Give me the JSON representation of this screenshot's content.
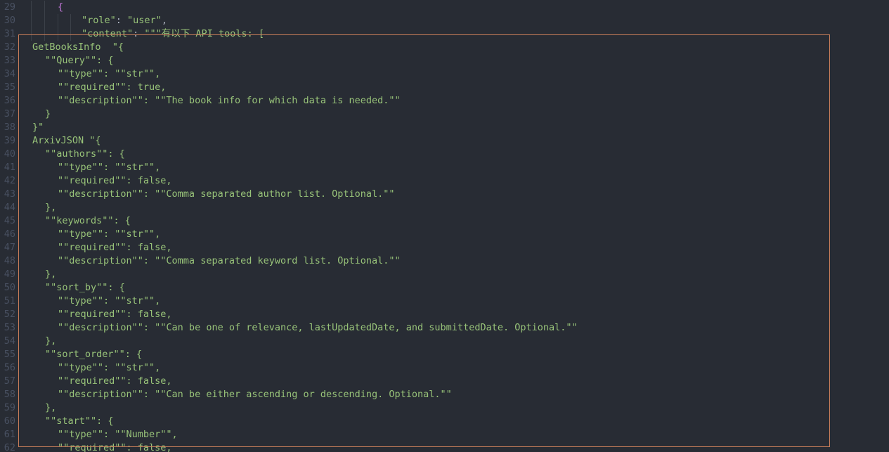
{
  "editor": {
    "lines": [
      {
        "n": "29",
        "ind": 82,
        "guides": [
          44,
          63
        ],
        "segs": [
          {
            "c": "b",
            "t": "{"
          }
        ]
      },
      {
        "n": "30",
        "ind": 116,
        "guides": [
          44,
          63,
          82,
          100
        ],
        "segs": [
          {
            "c": "s",
            "t": "\"role\""
          },
          {
            "c": "p",
            "t": ": "
          },
          {
            "c": "s",
            "t": "\"user\""
          },
          {
            "c": "p",
            "t": ","
          }
        ]
      },
      {
        "n": "31",
        "ind": 116,
        "guides": [
          44,
          63,
          82,
          100
        ],
        "segs": [
          {
            "c": "s",
            "t": "\"content\""
          },
          {
            "c": "p",
            "t": ": "
          },
          {
            "c": "s",
            "t": "\"\"\"有以下 API tools: ["
          }
        ]
      },
      {
        "n": "32",
        "ind": 46,
        "guides": [],
        "segs": [
          {
            "c": "t",
            "t": "GetBooksInfo  \"{"
          }
        ]
      },
      {
        "n": "33",
        "ind": 64,
        "guides": [],
        "segs": [
          {
            "c": "t",
            "t": "\"\"Query\"\": {"
          }
        ]
      },
      {
        "n": "34",
        "ind": 82,
        "guides": [],
        "segs": [
          {
            "c": "t",
            "t": "\"\"type\"\": \"\"str\"\","
          }
        ]
      },
      {
        "n": "35",
        "ind": 82,
        "guides": [],
        "segs": [
          {
            "c": "t",
            "t": "\"\"required\"\": true,"
          }
        ]
      },
      {
        "n": "36",
        "ind": 82,
        "guides": [],
        "segs": [
          {
            "c": "t",
            "t": "\"\"description\"\": \"\"The book info for which data is needed.\"\""
          }
        ]
      },
      {
        "n": "37",
        "ind": 64,
        "guides": [],
        "segs": [
          {
            "c": "t",
            "t": "}"
          }
        ]
      },
      {
        "n": "38",
        "ind": 46,
        "guides": [],
        "segs": [
          {
            "c": "t",
            "t": "}\""
          }
        ]
      },
      {
        "n": "39",
        "ind": 46,
        "guides": [],
        "segs": [
          {
            "c": "t",
            "t": "ArxivJSON \"{"
          }
        ]
      },
      {
        "n": "40",
        "ind": 64,
        "guides": [],
        "segs": [
          {
            "c": "t",
            "t": "\"\"authors\"\": {"
          }
        ]
      },
      {
        "n": "41",
        "ind": 82,
        "guides": [],
        "segs": [
          {
            "c": "t",
            "t": "\"\"type\"\": \"\"str\"\","
          }
        ]
      },
      {
        "n": "42",
        "ind": 82,
        "guides": [],
        "segs": [
          {
            "c": "t",
            "t": "\"\"required\"\": false,"
          }
        ]
      },
      {
        "n": "43",
        "ind": 82,
        "guides": [],
        "segs": [
          {
            "c": "t",
            "t": "\"\"description\"\": \"\"Comma separated author list. Optional.\"\""
          }
        ]
      },
      {
        "n": "44",
        "ind": 64,
        "guides": [],
        "segs": [
          {
            "c": "t",
            "t": "},"
          }
        ]
      },
      {
        "n": "45",
        "ind": 64,
        "guides": [],
        "segs": [
          {
            "c": "t",
            "t": "\"\"keywords\"\": {"
          }
        ]
      },
      {
        "n": "46",
        "ind": 82,
        "guides": [],
        "segs": [
          {
            "c": "t",
            "t": "\"\"type\"\": \"\"str\"\","
          }
        ]
      },
      {
        "n": "47",
        "ind": 82,
        "guides": [],
        "segs": [
          {
            "c": "t",
            "t": "\"\"required\"\": false,"
          }
        ]
      },
      {
        "n": "48",
        "ind": 82,
        "guides": [],
        "segs": [
          {
            "c": "t",
            "t": "\"\"description\"\": \"\"Comma separated keyword list. Optional.\"\""
          }
        ]
      },
      {
        "n": "49",
        "ind": 64,
        "guides": [],
        "segs": [
          {
            "c": "t",
            "t": "},"
          }
        ]
      },
      {
        "n": "50",
        "ind": 64,
        "guides": [],
        "segs": [
          {
            "c": "t",
            "t": "\"\"sort_by\"\": {"
          }
        ]
      },
      {
        "n": "51",
        "ind": 82,
        "guides": [],
        "segs": [
          {
            "c": "t",
            "t": "\"\"type\"\": \"\"str\"\","
          }
        ]
      },
      {
        "n": "52",
        "ind": 82,
        "guides": [],
        "segs": [
          {
            "c": "t",
            "t": "\"\"required\"\": false,"
          }
        ]
      },
      {
        "n": "53",
        "ind": 82,
        "guides": [],
        "segs": [
          {
            "c": "t",
            "t": "\"\"description\"\": \"\"Can be one of relevance, lastUpdatedDate, and submittedDate. Optional.\"\""
          }
        ]
      },
      {
        "n": "54",
        "ind": 64,
        "guides": [],
        "segs": [
          {
            "c": "t",
            "t": "},"
          }
        ]
      },
      {
        "n": "55",
        "ind": 64,
        "guides": [],
        "segs": [
          {
            "c": "t",
            "t": "\"\"sort_order\"\": {"
          }
        ]
      },
      {
        "n": "56",
        "ind": 82,
        "guides": [],
        "segs": [
          {
            "c": "t",
            "t": "\"\"type\"\": \"\"str\"\","
          }
        ]
      },
      {
        "n": "57",
        "ind": 82,
        "guides": [],
        "segs": [
          {
            "c": "t",
            "t": "\"\"required\"\": false,"
          }
        ]
      },
      {
        "n": "58",
        "ind": 82,
        "guides": [],
        "segs": [
          {
            "c": "t",
            "t": "\"\"description\"\": \"\"Can be either ascending or descending. Optional.\"\""
          }
        ]
      },
      {
        "n": "59",
        "ind": 64,
        "guides": [],
        "segs": [
          {
            "c": "t",
            "t": "},"
          }
        ]
      },
      {
        "n": "60",
        "ind": 64,
        "guides": [],
        "segs": [
          {
            "c": "t",
            "t": "\"\"start\"\": {"
          }
        ]
      },
      {
        "n": "61",
        "ind": 82,
        "guides": [],
        "segs": [
          {
            "c": "t",
            "t": "\"\"type\"\": \"\"Number\"\","
          }
        ]
      },
      {
        "n": "62",
        "ind": 82,
        "guides": [],
        "segs": [
          {
            "c": "t",
            "t": "\"\"required\"\": false,"
          }
        ]
      }
    ]
  },
  "colors": {
    "background": "#282c34",
    "line_number": "#495162",
    "string": "#98c379",
    "punctuation": "#abb2bf",
    "bracket": "#c678dd",
    "selection_border": "#c97e5a"
  }
}
